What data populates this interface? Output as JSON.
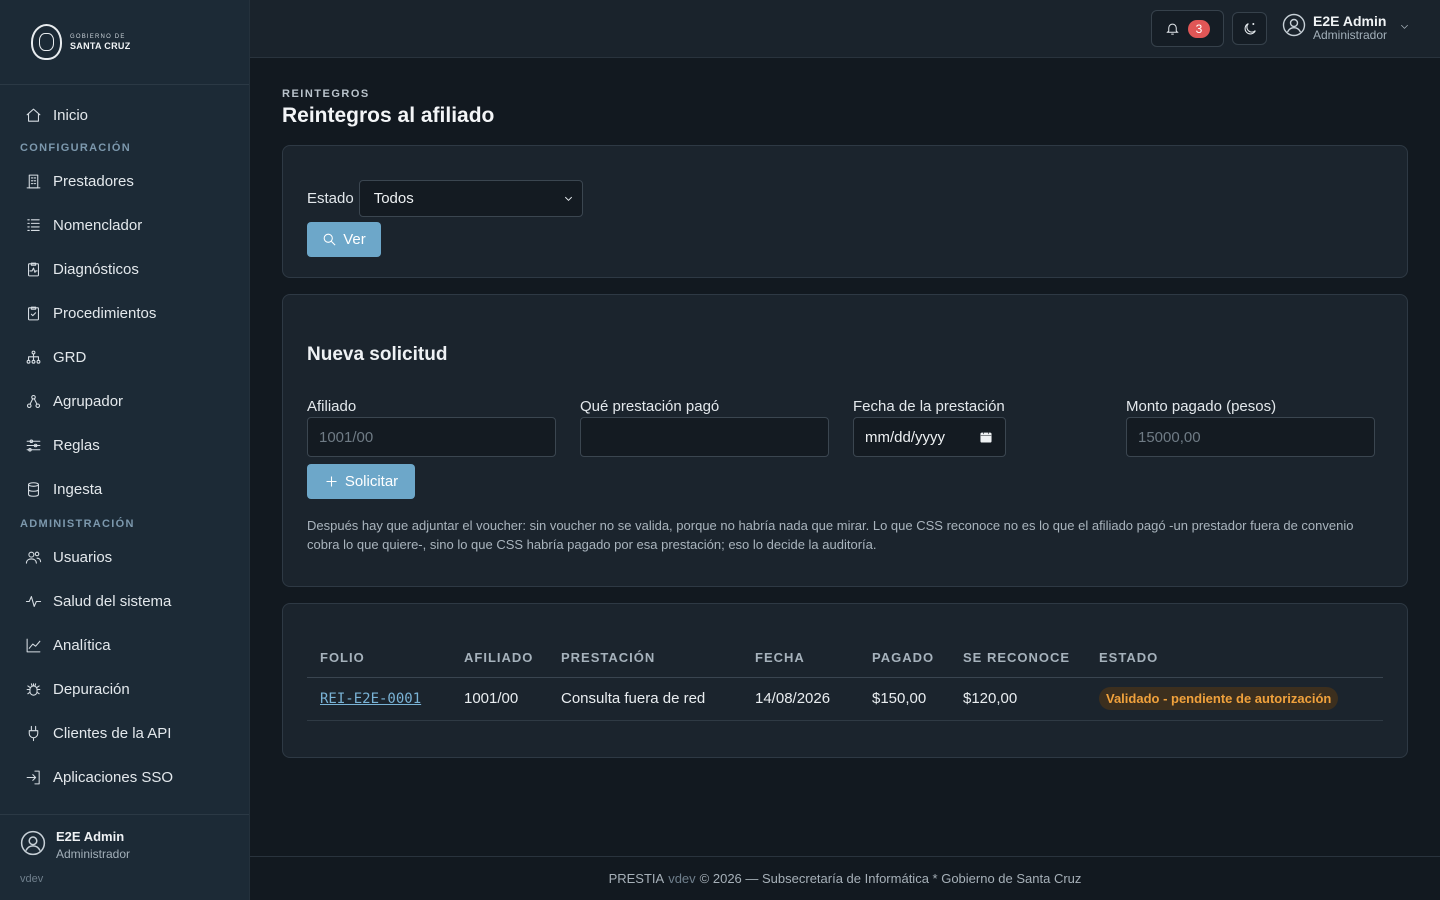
{
  "brand": {
    "line1": "GOBIERNO DE",
    "line2": "SANTA CRUZ"
  },
  "sidebar": {
    "items": [
      {
        "label": "Inicio",
        "icon": "home-icon"
      },
      {
        "section": "CONFIGURACIÓN"
      },
      {
        "label": "Prestadores",
        "icon": "building-icon"
      },
      {
        "label": "Nomenclador",
        "icon": "list-icon"
      },
      {
        "label": "Diagnósticos",
        "icon": "clipboard-pulse-icon"
      },
      {
        "label": "Procedimientos",
        "icon": "clipboard-check-icon"
      },
      {
        "label": "GRD",
        "icon": "hierarchy-icon"
      },
      {
        "label": "Agrupador",
        "icon": "group-icon"
      },
      {
        "label": "Reglas",
        "icon": "sliders-icon"
      },
      {
        "label": "Ingesta",
        "icon": "database-icon"
      },
      {
        "section": "ADMINISTRACIÓN"
      },
      {
        "label": "Usuarios",
        "icon": "users-icon"
      },
      {
        "label": "Salud del sistema",
        "icon": "activity-icon"
      },
      {
        "label": "Analítica",
        "icon": "chart-line-icon"
      },
      {
        "label": "Depuración",
        "icon": "bug-icon"
      },
      {
        "label": "Clientes de la API",
        "icon": "plug-icon"
      },
      {
        "label": "Aplicaciones SSO",
        "icon": "sign-in-icon"
      }
    ],
    "user": {
      "name": "E2E Admin",
      "role": "Administrador",
      "version": "vdev"
    }
  },
  "topbar": {
    "notifications": "3",
    "user": {
      "name": "E2E Admin",
      "role": "Administrador"
    }
  },
  "page": {
    "eyebrow": "REINTEGROS",
    "title": "Reintegros al afiliado"
  },
  "filter": {
    "label": "Estado",
    "selected": "Todos",
    "button": "Ver"
  },
  "form": {
    "title": "Nueva solicitud",
    "afiliado": {
      "label": "Afiliado",
      "placeholder": "1001/00"
    },
    "prestacion": {
      "label": "Qué prestación pagó",
      "placeholder": ""
    },
    "fecha": {
      "label": "Fecha de la prestación",
      "placeholder": "mm/dd/yyyy"
    },
    "monto": {
      "label": "Monto pagado (pesos)",
      "placeholder": "15000,00"
    },
    "submit": "Solicitar",
    "help": "Después hay que adjuntar el voucher: sin voucher no se valida, porque no habría nada que mirar. Lo que CSS reconoce no es lo que el afiliado pagó -un prestador fuera de convenio cobra lo que quiere-, sino lo que CSS habría pagado por esa prestación; eso lo decide la auditoría."
  },
  "table": {
    "headers": [
      "FOLIO",
      "AFILIADO",
      "PRESTACIÓN",
      "FECHA",
      "PAGADO",
      "SE RECONOCE",
      "ESTADO"
    ],
    "rows": [
      {
        "folio": "REI-E2E-0001",
        "afiliado": "1001/00",
        "prestacion": "Consulta fuera de red",
        "fecha": "14/08/2026",
        "pagado": "$150,00",
        "reconoce": "$120,00",
        "estado": "Validado - pendiente de autorización"
      }
    ]
  },
  "footer": {
    "app": "PRESTIA",
    "version": "vdev",
    "rest": "© 2026 — Subsecretaría de Informática * Gobierno de Santa Cruz"
  },
  "colors": {
    "accent": "#6da7c9",
    "status_warning": "#f0a13c",
    "sidebar_bg": "#1c2a36",
    "page_bg": "#121920"
  }
}
